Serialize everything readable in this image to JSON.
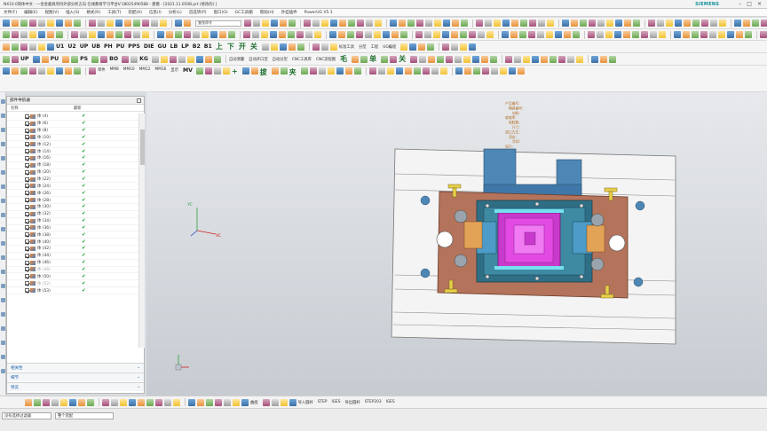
{
  "window": {
    "title": "NX10.0简体中文 - 一金金磨具项目外部分析方向 在线教育学习平台V:18025490588 - 建模 - [2021.11.050B.prt (修改的) ]",
    "active_tab": "上海中 \\\\系统分析4",
    "brand": "SIEMENS"
  },
  "menu": [
    "文件(F)",
    "编辑(E)",
    "视图(V)",
    "插入(S)",
    "格式(R)",
    "工具(T)",
    "装配(A)",
    "信息(I)",
    "分析(L)",
    "首选项(P)",
    "窗口(O)",
    "GC工具箱",
    "帮助(H)",
    "外挂插件",
    "PowerUG V5.1"
  ],
  "toolbar1": {
    "command_search_placeholder": "查找命令"
  },
  "toolbar3": {
    "macros": [
      "U1",
      "U2",
      "UP",
      "UB",
      "PH",
      "PU",
      "PPS",
      "DIE",
      "GU",
      "LB",
      "LP",
      "B2",
      "B1"
    ],
    "chars": [
      "上",
      "下",
      "开",
      "关"
    ],
    "labels": [
      "标准工具",
      "分型",
      "工程",
      "UG编程"
    ]
  },
  "toolbar4": {
    "macros": [
      "UP",
      "PU",
      "PS",
      "BO",
      "KG"
    ],
    "labels": [
      "自动测量",
      "自动开口型",
      "自动分型",
      "CNC工具库",
      "CNC流程图"
    ],
    "chars": [
      "毛",
      "单",
      "关"
    ]
  },
  "toolbar5": {
    "labels": [
      "单件",
      "MM8",
      "MM10",
      "MM12",
      "MM16",
      "显示"
    ],
    "macros": [
      "MV"
    ],
    "chars": [
      "+",
      "拔",
      "夹"
    ]
  },
  "panel": {
    "title": "部件导航器",
    "col_name": "名称",
    "col_latest": "最新",
    "rows": [
      {
        "label": "体 (4)",
        "dim": false
      },
      {
        "label": "体 (6)",
        "dim": false
      },
      {
        "label": "体 (8)",
        "dim": false
      },
      {
        "label": "体 (10)",
        "dim": false
      },
      {
        "label": "体 (12)",
        "dim": false
      },
      {
        "label": "体 (14)",
        "dim": false
      },
      {
        "label": "体 (16)",
        "dim": false
      },
      {
        "label": "体 (18)",
        "dim": false
      },
      {
        "label": "体 (20)",
        "dim": false
      },
      {
        "label": "体 (22)",
        "dim": false
      },
      {
        "label": "体 (24)",
        "dim": false
      },
      {
        "label": "体 (26)",
        "dim": false
      },
      {
        "label": "体 (28)",
        "dim": false
      },
      {
        "label": "体 (30)",
        "dim": false
      },
      {
        "label": "体 (32)",
        "dim": false
      },
      {
        "label": "体 (34)",
        "dim": false
      },
      {
        "label": "体 (36)",
        "dim": false
      },
      {
        "label": "体 (38)",
        "dim": false
      },
      {
        "label": "体 (40)",
        "dim": false
      },
      {
        "label": "体 (42)",
        "dim": false
      },
      {
        "label": "体 (44)",
        "dim": false
      },
      {
        "label": "体 (46)",
        "dim": false
      },
      {
        "label": "体 (48)",
        "dim": true
      },
      {
        "label": "体 (50)",
        "dim": false
      },
      {
        "label": "体 (52)",
        "dim": true
      },
      {
        "label": "体 (53)",
        "dim": false
      }
    ],
    "sections": [
      "相关性",
      "细节",
      "预览"
    ]
  },
  "axis": {
    "x": "XC",
    "y": "YC"
  },
  "bottom_toolbar": {
    "labels": [
      "导入圆杆",
      "STEP",
      "IGES",
      "导出圆杆",
      "STEP203",
      "IGES"
    ],
    "extra": "曲面"
  },
  "statusbar": {
    "filter_value": "没有选择过滤器",
    "assembly_value": "整个装配"
  },
  "notes": [
    "产品编号：",
    "模具编号：",
    "材料：",
    "收缩率：",
    "型腔数：",
    "尺寸：",
    "浇口方式：",
    "顶出：",
    "冷却：",
    "设计：",
    "日期：",
    "审核：",
    "备注：",
    "版本：",
    "重量："
  ]
}
